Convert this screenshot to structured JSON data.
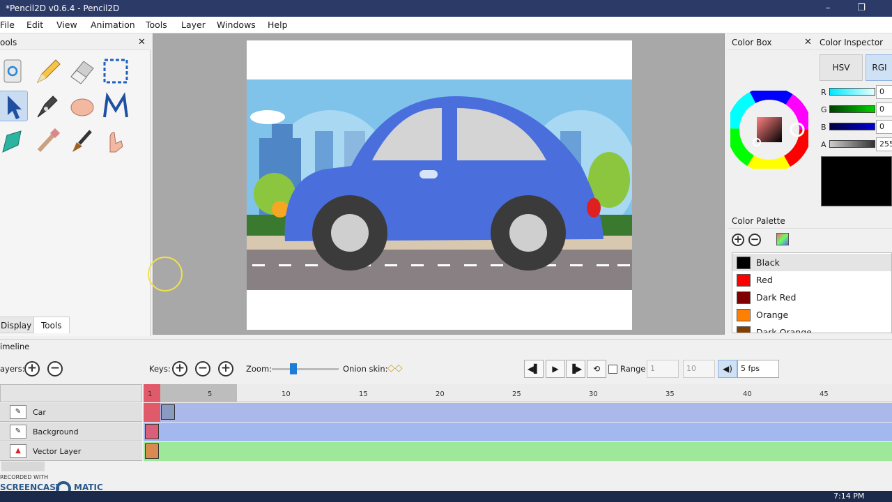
{
  "window": {
    "title": "*Pencil2D v0.6.4 - Pencil2D"
  },
  "menu": {
    "items": [
      "File",
      "Edit",
      "View",
      "Animation",
      "Tools",
      "Layer",
      "Windows",
      "Help"
    ]
  },
  "tools_panel": {
    "title": "ools",
    "tools": [
      "clear-icon",
      "pencil-icon",
      "eraser-icon",
      "select-icon",
      "pointer-icon",
      "pen-icon",
      "hand-icon",
      "polyline-icon",
      "bucket-icon",
      "eyedropper-icon",
      "brush-icon",
      "smudge-icon"
    ],
    "tabs": [
      "Display",
      "Tools"
    ]
  },
  "color_box": {
    "title": "Color Box"
  },
  "color_inspector": {
    "title": "Color Inspector",
    "modes": [
      "HSV",
      "RGI"
    ],
    "channels": [
      {
        "label": "R",
        "value": "0"
      },
      {
        "label": "G",
        "value": "0"
      },
      {
        "label": "B",
        "value": "0"
      },
      {
        "label": "A",
        "value": "255"
      }
    ],
    "current_color": "#000000"
  },
  "color_palette": {
    "title": "Color Palette",
    "colors": [
      {
        "name": "Black",
        "hex": "#000000"
      },
      {
        "name": "Red",
        "hex": "#ff0000"
      },
      {
        "name": "Dark Red",
        "hex": "#800000"
      },
      {
        "name": "Orange",
        "hex": "#ff8000"
      },
      {
        "name": "Dark Orange",
        "hex": "#804000"
      }
    ]
  },
  "timeline": {
    "title": "imeline",
    "layers_label": "ayers:",
    "keys_label": "Keys:",
    "zoom_label": "Zoom:",
    "onion_label": "Onion skin:",
    "range_label": "Range",
    "range_start": "1",
    "range_end": "10",
    "fps": "5 fps",
    "ticks": [
      "1",
      "5",
      "10",
      "15",
      "20",
      "25",
      "30",
      "35",
      "40",
      "45"
    ],
    "layers": [
      {
        "name": "Car",
        "color": "#aab8ea"
      },
      {
        "name": "Background",
        "color": "#a3b8ee"
      },
      {
        "name": "Vector Layer",
        "color": "#9ee89a"
      }
    ]
  },
  "watermark": {
    "line1": "RECORDED WITH",
    "line2": "SCREENCAST",
    "line3": "MATIC"
  },
  "taskbar": {
    "time": "7:14 PM"
  }
}
